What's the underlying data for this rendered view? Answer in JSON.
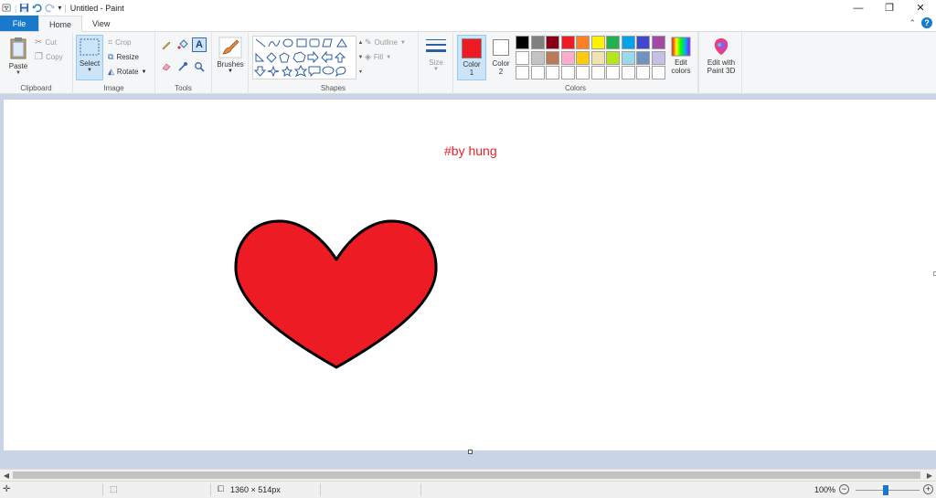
{
  "window": {
    "title": "Untitled - Paint"
  },
  "tabs": {
    "file": "File",
    "home": "Home",
    "view": "View"
  },
  "ribbon": {
    "clipboard": {
      "paste": "Paste",
      "cut": "Cut",
      "copy": "Copy",
      "group": "Clipboard"
    },
    "image": {
      "select": "Select",
      "crop": "Crop",
      "resize": "Resize",
      "rotate": "Rotate",
      "group": "Image"
    },
    "tools": {
      "group": "Tools"
    },
    "brushes": {
      "label": "Brushes"
    },
    "shapes": {
      "outline": "Outline",
      "fill": "Fill",
      "group": "Shapes"
    },
    "size": {
      "label": "Size"
    },
    "colors": {
      "color1_label": "Color",
      "color1_num": "1",
      "color2_label": "Color",
      "color2_num": "2",
      "edit_colors_1": "Edit",
      "edit_colors_2": "colors",
      "group": "Colors",
      "color1": "#ed1c24",
      "color2": "#ffffff",
      "palette": [
        "#000000",
        "#7f7f7f",
        "#880015",
        "#ed1c24",
        "#ff7f27",
        "#fff200",
        "#22b14c",
        "#00a2e8",
        "#3f48cc",
        "#a349a4",
        "#ffffff",
        "#c3c3c3",
        "#b97a57",
        "#ffaec9",
        "#ffc90e",
        "#efe4b0",
        "#b5e61d",
        "#99d9ea",
        "#7092be",
        "#c8bfe7",
        "#ffffff",
        "#ffffff",
        "#ffffff",
        "#ffffff",
        "#ffffff",
        "#ffffff",
        "#ffffff",
        "#ffffff",
        "#ffffff",
        "#ffffff"
      ]
    },
    "paint3d": {
      "line1": "Edit with",
      "line2": "Paint 3D"
    }
  },
  "canvas": {
    "text": "#by hung",
    "heart_color": "#ed1c24",
    "text_color": "#ed1c24"
  },
  "status": {
    "image_size": "1360 × 514px",
    "zoom": "100%"
  }
}
